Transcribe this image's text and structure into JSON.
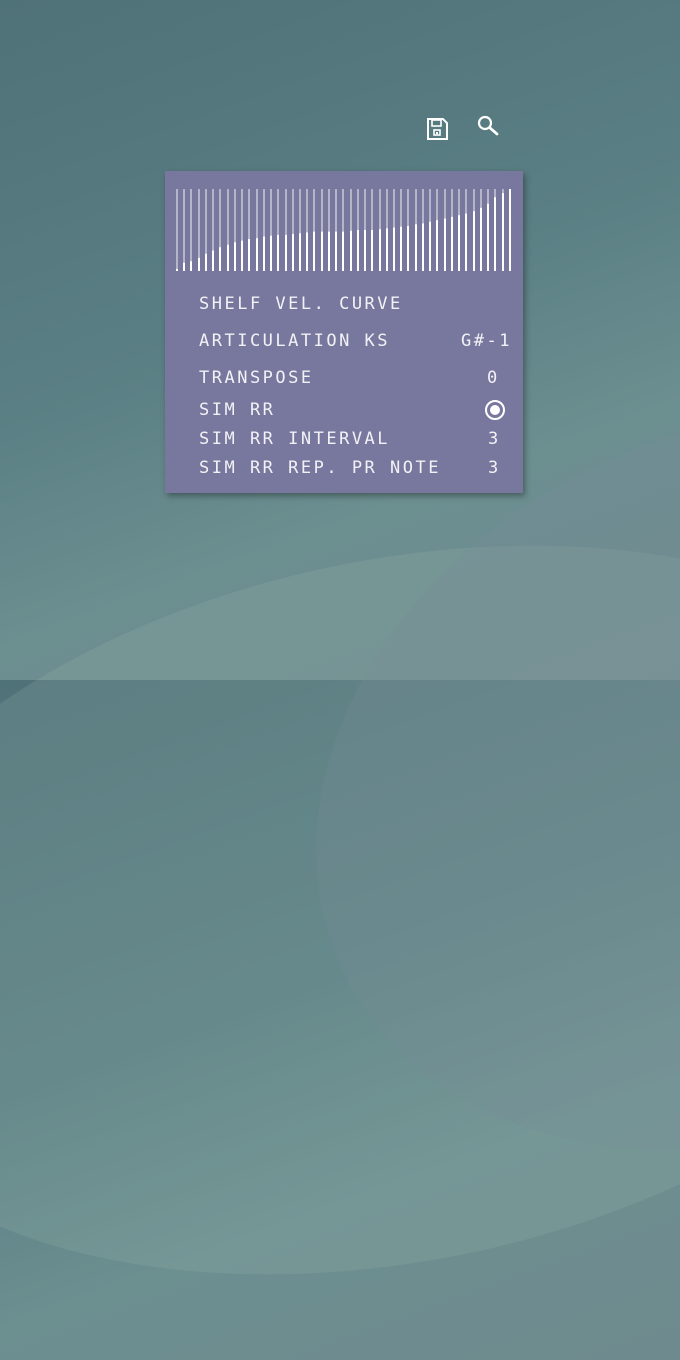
{
  "toolbar": {
    "save_icon": "floppy-disk-icon",
    "search_icon": "magnifier-icon"
  },
  "panel": {
    "velocity_curve": {
      "values": [
        0.0,
        0.1,
        0.12,
        0.16,
        0.21,
        0.25,
        0.29,
        0.32,
        0.35,
        0.37,
        0.39,
        0.4,
        0.42,
        0.43,
        0.44,
        0.44,
        0.45,
        0.46,
        0.47,
        0.48,
        0.48,
        0.48,
        0.48,
        0.48,
        0.49,
        0.5,
        0.5,
        0.5,
        0.51,
        0.52,
        0.53,
        0.54,
        0.55,
        0.57,
        0.58,
        0.6,
        0.62,
        0.64,
        0.66,
        0.68,
        0.7,
        0.73,
        0.77,
        0.82,
        0.9,
        0.95,
        1.0
      ]
    },
    "rows": {
      "shelf_vel_curve": {
        "label": "SHELF VEL. CURVE"
      },
      "articulation_ks": {
        "label": "ARTICULATION KS",
        "value": "G#-1"
      },
      "transpose": {
        "label": "TRANSPOSE",
        "value": "0"
      },
      "sim_rr": {
        "label": "SIM RR",
        "enabled": true
      },
      "sim_rr_interval": {
        "label": "SIM RR INTERVAL",
        "value": "3"
      },
      "sim_rr_rep": {
        "label": "SIM RR REP. PR NOTE",
        "value": "3"
      }
    }
  },
  "colors": {
    "panel_bg": "#78789f",
    "text": "#f2f2f6"
  }
}
